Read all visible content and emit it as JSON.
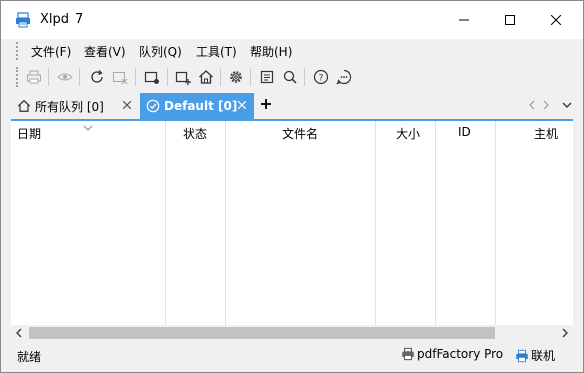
{
  "window": {
    "title": "Xlpd",
    "version": "7"
  },
  "menu": {
    "items": [
      {
        "label": "文件(F)"
      },
      {
        "label": "查看(V)"
      },
      {
        "label": "队列(Q)"
      },
      {
        "label": "工具(T)"
      },
      {
        "label": "帮助(H)"
      }
    ]
  },
  "toolbar": {
    "icons": [
      "print-icon",
      "eye-icon",
      "refresh-icon",
      "remove-icon",
      "new-window-icon",
      "add-window-icon",
      "home-icon",
      "settings-gear-icon",
      "document-icon",
      "search-icon",
      "help-icon",
      "chat-icon"
    ]
  },
  "tabs": [
    {
      "label": "所有队列 [0]",
      "icon": "home-icon",
      "active": false
    },
    {
      "label": "Default [0]",
      "icon": "check-circle-icon",
      "active": true
    }
  ],
  "list": {
    "columns": [
      "日期",
      "状态",
      "文件名",
      "大小",
      "ID",
      "主机"
    ],
    "rows": []
  },
  "status": {
    "text": "就绪",
    "printer": "pdfFactory Pro",
    "connection": "联机"
  },
  "colors": {
    "accent": "#4a9ee8",
    "background": "#f0f0f0"
  }
}
